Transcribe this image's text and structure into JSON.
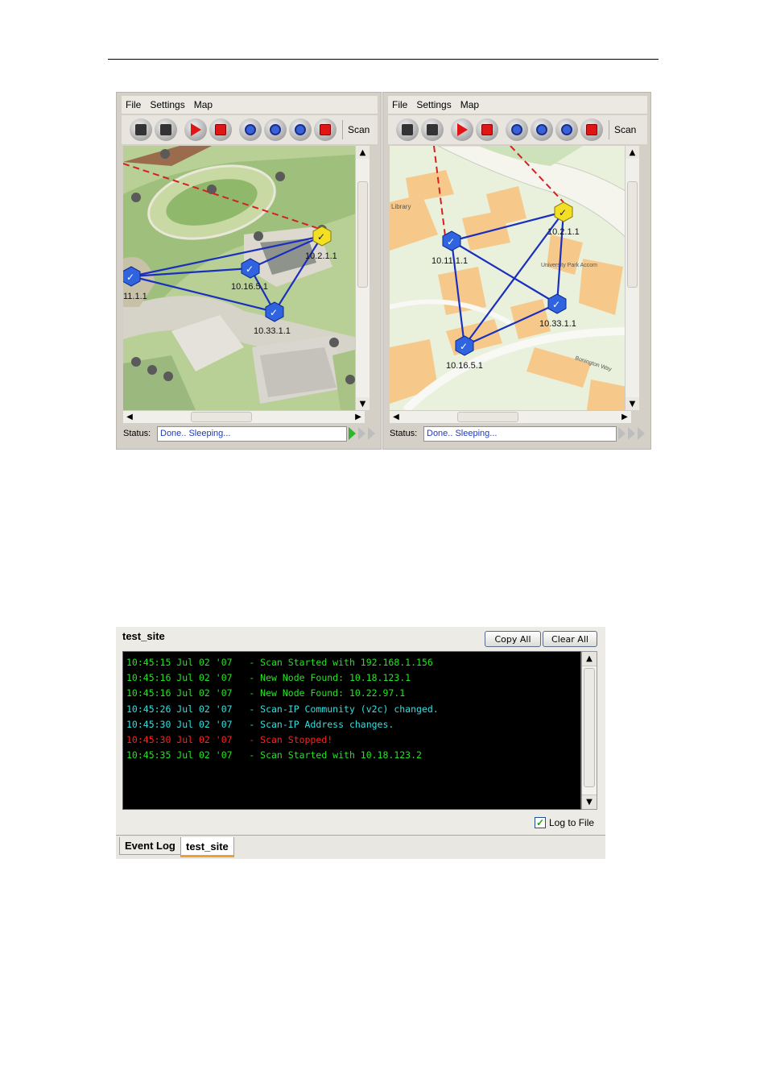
{
  "menu": [
    "File",
    "Settings",
    "Map"
  ],
  "toolbar": {
    "scan_label": "Scan",
    "buttons": [
      "open-icon",
      "save-icon",
      "play-icon",
      "stop-icon",
      "zoom-in-icon",
      "zoom-out-icon",
      "zoom-fit-icon",
      "stop-sign-icon"
    ]
  },
  "left_map": {
    "nodes": [
      {
        "label": "10.2.1.1",
        "status": "gateway"
      },
      {
        "label": "10.16.5.1",
        "status": "ok"
      },
      {
        "label": "11.1.1",
        "status": "ok"
      },
      {
        "label": "10.33.1.1",
        "status": "ok"
      }
    ],
    "status_label": "Status:",
    "status_value": "Done.. Sleeping..."
  },
  "right_map": {
    "nodes": [
      {
        "label": "10.2.1.1",
        "status": "gateway"
      },
      {
        "label": "10.11.1.1",
        "status": "ok"
      },
      {
        "label": "10.33.1.1",
        "status": "ok"
      },
      {
        "label": "10.16.5.1",
        "status": "ok"
      }
    ],
    "map_text": [
      "Library",
      "University Park Accom",
      "Bonington Way"
    ],
    "status_label": "Status:",
    "status_value": "Done.. Sleeping..."
  },
  "log": {
    "title": "test_site",
    "copy_all": "Copy All",
    "clear_all": "Clear All",
    "lines": [
      {
        "text": "10:45:15 Jul 02 '07   - Scan Started with 192.168.1.156",
        "color": "#25e325"
      },
      {
        "text": "10:45:16 Jul 02 '07   - New Node Found: 10.18.123.1",
        "color": "#25e325"
      },
      {
        "text": "10:45:16 Jul 02 '07   - New Node Found: 10.22.97.1",
        "color": "#25e325"
      },
      {
        "text": "10:45:26 Jul 02 '07   - Scan-IP Community (v2c) changed.",
        "color": "#2fe0e0"
      },
      {
        "text": "10:45:30 Jul 02 '07   - Scan-IP Address changes.",
        "color": "#2fe0e0"
      },
      {
        "text": "10:45:30 Jul 02 '07   - Scan Stopped!",
        "color": "#ff2020"
      },
      {
        "text": "10:45:35 Jul 02 '07   - Scan Started with 10.18.123.2",
        "color": "#25e325"
      }
    ],
    "log_to_file": "Log to File",
    "log_to_file_checked": true,
    "tabs": [
      "Event Log",
      "test_site"
    ],
    "active_tab": "test_site"
  }
}
